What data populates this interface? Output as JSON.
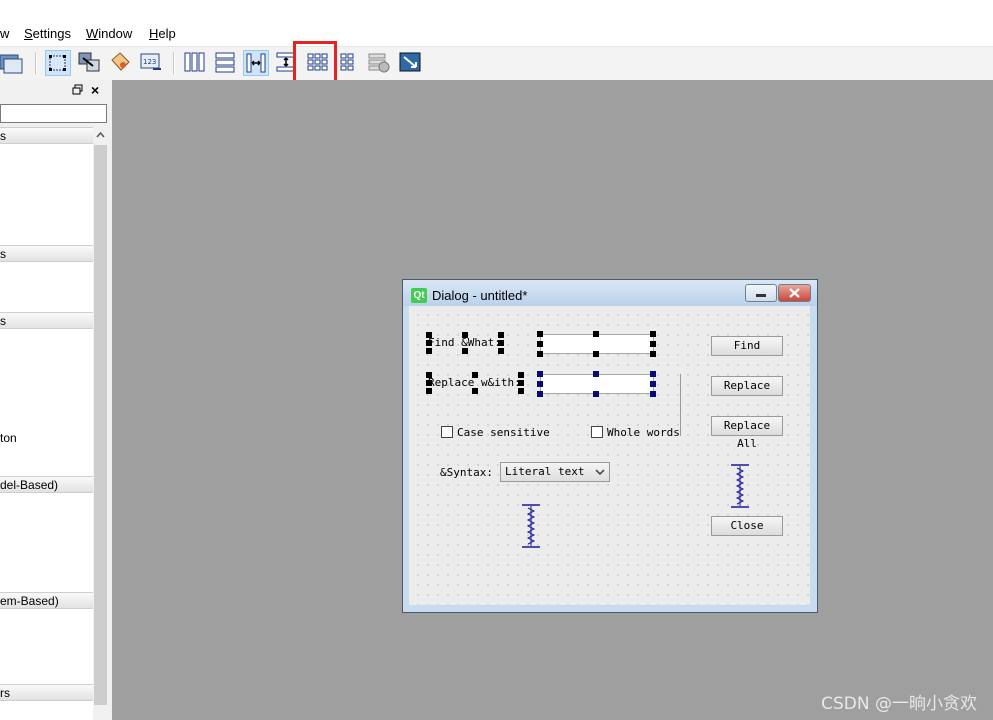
{
  "menubar": {
    "items": [
      {
        "label": "w",
        "mnemonic": ""
      },
      {
        "label": "Settings",
        "mnemonic": "S"
      },
      {
        "label": "Window",
        "mnemonic": "W"
      },
      {
        "label": "Help",
        "mnemonic": "H"
      }
    ]
  },
  "toolbar": {
    "buttons": [
      {
        "icon": "edit-widgets-icon"
      },
      {
        "icon": "edit-signals-slots-icon"
      },
      {
        "icon": "edit-buddies-icon"
      },
      {
        "icon": "edit-tab-order-icon"
      },
      {
        "icon": "layout-horizontal-icon"
      },
      {
        "icon": "layout-vertical-icon"
      },
      {
        "icon": "layout-horizontal-splitter-icon"
      },
      {
        "icon": "layout-vertical-splitter-icon"
      },
      {
        "icon": "layout-grid-icon"
      },
      {
        "icon": "layout-form-icon"
      },
      {
        "icon": "break-layout-icon"
      },
      {
        "icon": "adjust-size-icon"
      }
    ],
    "highlight_color": "#e62222"
  },
  "widget_box": {
    "filter_placeholder": "",
    "categories": [
      {
        "label": "s"
      },
      {
        "label": "s"
      },
      {
        "label": "s"
      },
      {
        "label": "del-Based)"
      },
      {
        "label": "em-Based)"
      },
      {
        "label": "rs"
      }
    ],
    "items": [
      {
        "label": "ton"
      }
    ]
  },
  "dialog": {
    "title": "Dialog - untitled*",
    "logo_text": "Qt",
    "labels": {
      "find_what": "Find &What:",
      "replace_with": "Replace w&ith:",
      "syntax": "&Syntax:"
    },
    "checkboxes": {
      "case_sensitive": "Case sensitive",
      "whole_words": "Whole words"
    },
    "combo": {
      "syntax_value": "Literal text"
    },
    "buttons": {
      "find": "Find",
      "replace": "Replace",
      "replace_all": "Replace All",
      "close": "Close"
    }
  },
  "watermark": "CSDN @一晌小贪欢"
}
